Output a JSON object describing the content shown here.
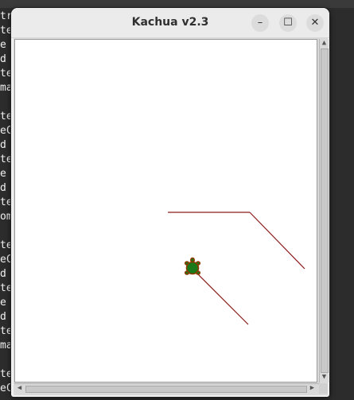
{
  "terminal": {
    "lines": [
      "tr",
      "te",
      "e",
      "d",
      "te",
      "ma",
      "",
      "te",
      "eC",
      "d",
      "te",
      "e",
      "d",
      "te",
      "om",
      "",
      "te",
      "eC",
      "d",
      "te",
      "e",
      "d",
      "te",
      "ma",
      "",
      "te",
      "eC"
    ]
  },
  "window": {
    "title": "Kachua v2.3",
    "controls": {
      "minimize": "–",
      "maximize": "☐",
      "close": "✕"
    }
  },
  "colors": {
    "trail": "#8b1a1a",
    "turtle_body": "#1a7a1a",
    "turtle_outline": "#8b3a00"
  },
  "scrollbars": {
    "up": "▲",
    "down": "▼",
    "left": "◀",
    "right": "▶"
  },
  "icons": {
    "turtle": "turtle-icon"
  }
}
